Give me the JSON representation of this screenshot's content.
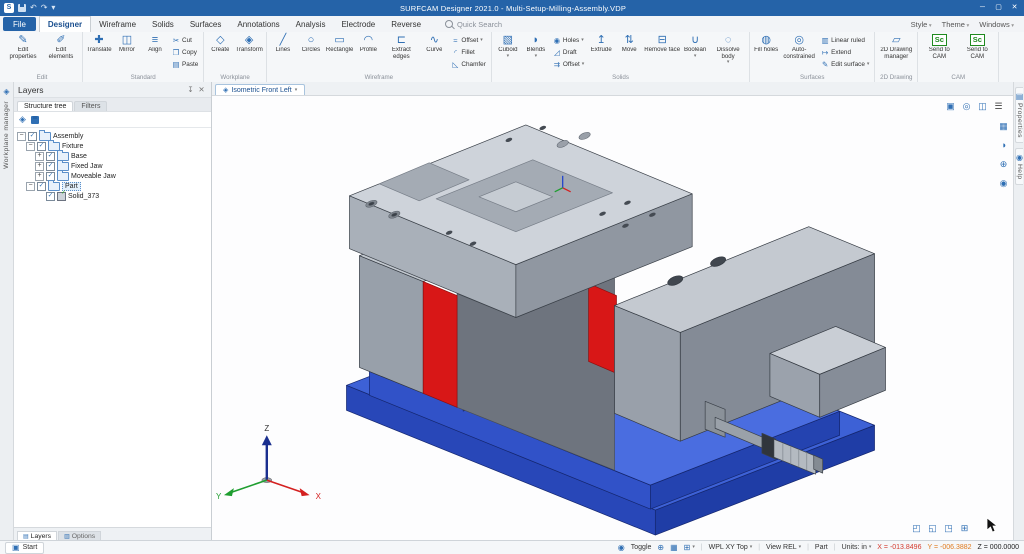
{
  "window": {
    "title": "SURFCAM Designer 2021.0 - Multi-Setup-Milling-Assembly.VDP",
    "controls": {
      "minimize": "─",
      "maximize": "▢",
      "close": "✕"
    }
  },
  "menu": {
    "file": "File",
    "tabs": [
      {
        "label": "Designer",
        "active": true
      },
      {
        "label": "Wireframe"
      },
      {
        "label": "Solids"
      },
      {
        "label": "Surfaces"
      },
      {
        "label": "Annotations"
      },
      {
        "label": "Analysis"
      },
      {
        "label": "Electrode"
      },
      {
        "label": "Reverse"
      }
    ],
    "quick_search": "Quick Search",
    "right": [
      {
        "label": "Style"
      },
      {
        "label": "Theme"
      },
      {
        "label": "Windows"
      }
    ]
  },
  "ribbon": {
    "groups": [
      {
        "label": "Edit",
        "cols": [
          {
            "t": "l",
            "items": [
              {
                "label": "Edit properties",
                "icon": "✎"
              },
              {
                "label": "Edit elements",
                "icon": "✐"
              }
            ]
          }
        ]
      },
      {
        "label": "Standard",
        "cols": [
          {
            "t": "l",
            "items": [
              {
                "label": "Translate",
                "icon": "✚"
              },
              {
                "label": "Mirror",
                "icon": "◫"
              },
              {
                "label": "Align",
                "icon": "≡"
              }
            ]
          },
          {
            "t": "s",
            "items": [
              {
                "label": "Cut",
                "icon": "✂"
              },
              {
                "label": "Copy",
                "icon": "❐"
              },
              {
                "label": "Paste",
                "icon": "▤"
              }
            ]
          }
        ]
      },
      {
        "label": "Workplane",
        "cols": [
          {
            "t": "l",
            "items": [
              {
                "label": "Create",
                "icon": "◇"
              },
              {
                "label": "Transform",
                "icon": "◈"
              }
            ]
          }
        ]
      },
      {
        "label": "Wireframe",
        "cols": [
          {
            "t": "l",
            "items": [
              {
                "label": "Lines",
                "icon": "╱"
              },
              {
                "label": "Circles",
                "icon": "○"
              },
              {
                "label": "Rectangle",
                "icon": "▭"
              },
              {
                "label": "Profile",
                "icon": "◠"
              },
              {
                "label": "Extract edges",
                "icon": "⊏"
              },
              {
                "label": "Curve",
                "icon": "∿"
              }
            ]
          },
          {
            "t": "s",
            "items": [
              {
                "label": "Offset",
                "icon": "≈",
                "caret": true
              },
              {
                "label": "Fillet",
                "icon": "◜"
              },
              {
                "label": "Chamfer",
                "icon": "◺"
              }
            ]
          }
        ]
      },
      {
        "label": "Solids",
        "cols": [
          {
            "t": "l",
            "items": [
              {
                "label": "Cuboid",
                "icon": "▧",
                "caret": true
              },
              {
                "label": "Blends",
                "icon": "◗",
                "caret": true
              }
            ]
          },
          {
            "t": "s",
            "items": [
              {
                "label": "Holes",
                "icon": "◉",
                "caret": true
              },
              {
                "label": "Draft",
                "icon": "◿"
              },
              {
                "label": "Offset",
                "icon": "⇉",
                "caret": true
              }
            ]
          },
          {
            "t": "l",
            "items": [
              {
                "label": "Extrude",
                "icon": "↥"
              },
              {
                "label": "Move",
                "icon": "⇅"
              },
              {
                "label": "Remove face",
                "icon": "⊟"
              },
              {
                "label": "Boolean",
                "icon": "∪",
                "caret": true
              },
              {
                "label": "Dissolve body",
                "icon": "◌",
                "caret": true
              }
            ]
          }
        ]
      },
      {
        "label": "Surfaces",
        "cols": [
          {
            "t": "l",
            "items": [
              {
                "label": "Fill holes",
                "icon": "◍"
              },
              {
                "label": "Auto-constrained",
                "icon": "◎"
              }
            ]
          },
          {
            "t": "s",
            "items": [
              {
                "label": "Linear ruled",
                "icon": "▥"
              },
              {
                "label": "Extend",
                "icon": "↦"
              },
              {
                "label": "Edit surface",
                "icon": "✎",
                "caret": true
              }
            ]
          }
        ]
      },
      {
        "label": "2D Drawing",
        "cols": [
          {
            "t": "l",
            "items": [
              {
                "label": "2D Drawing manager",
                "icon": "▱"
              }
            ]
          }
        ]
      },
      {
        "label": "CAM",
        "cols": [
          {
            "t": "l",
            "items": [
              {
                "label": "Send to CAM",
                "icon": "SC"
              },
              {
                "label": "Send to CAM",
                "icon": "SC"
              }
            ]
          }
        ]
      }
    ]
  },
  "layers_panel": {
    "title": "Layers",
    "tabs": [
      {
        "label": "Structure tree",
        "active": true
      },
      {
        "label": "Filters"
      }
    ],
    "tree": [
      {
        "d": 0,
        "t": "minus",
        "icon": "folder",
        "label": "Assembly"
      },
      {
        "d": 1,
        "t": "minus",
        "icon": "folder",
        "label": "Fixture"
      },
      {
        "d": 2,
        "t": "plus",
        "icon": "folder",
        "label": "Base"
      },
      {
        "d": 2,
        "t": "plus",
        "icon": "folder",
        "label": "Fixed Jaw"
      },
      {
        "d": 2,
        "t": "plus",
        "icon": "folder",
        "label": "Moveable Jaw"
      },
      {
        "d": 1,
        "t": "minus",
        "icon": "folder",
        "label": "Part",
        "selected": true
      },
      {
        "d": 2,
        "t": "none",
        "icon": "solid",
        "label": "Solid_373"
      }
    ],
    "bottom_tabs": [
      {
        "label": "Layers",
        "active": true
      },
      {
        "label": "Options"
      }
    ]
  },
  "left_strip": {
    "label": "Workplane manager"
  },
  "right_strip": {
    "tabs": [
      "Properties",
      "Help"
    ]
  },
  "viewport": {
    "view_tab": "Isometric Front Left",
    "triad": {
      "x": "X",
      "y": "Y",
      "z": "Z"
    }
  },
  "status_bar": {
    "start": "Start",
    "toggle": "Toggle",
    "wpl": "WPL XY Top",
    "view": "View REL",
    "part": "Part",
    "units": "Units: in",
    "coords": {
      "x": "X = -013.8496",
      "y": "Y = -006.3882",
      "z": "Z = 000.0000"
    }
  },
  "colors": {
    "titlebar": "#2563a8",
    "accent": "#2f6fb4",
    "base_blue": "#3d61d6",
    "highlight_red": "#d81717",
    "steel_gray": "#c4c9d0"
  }
}
